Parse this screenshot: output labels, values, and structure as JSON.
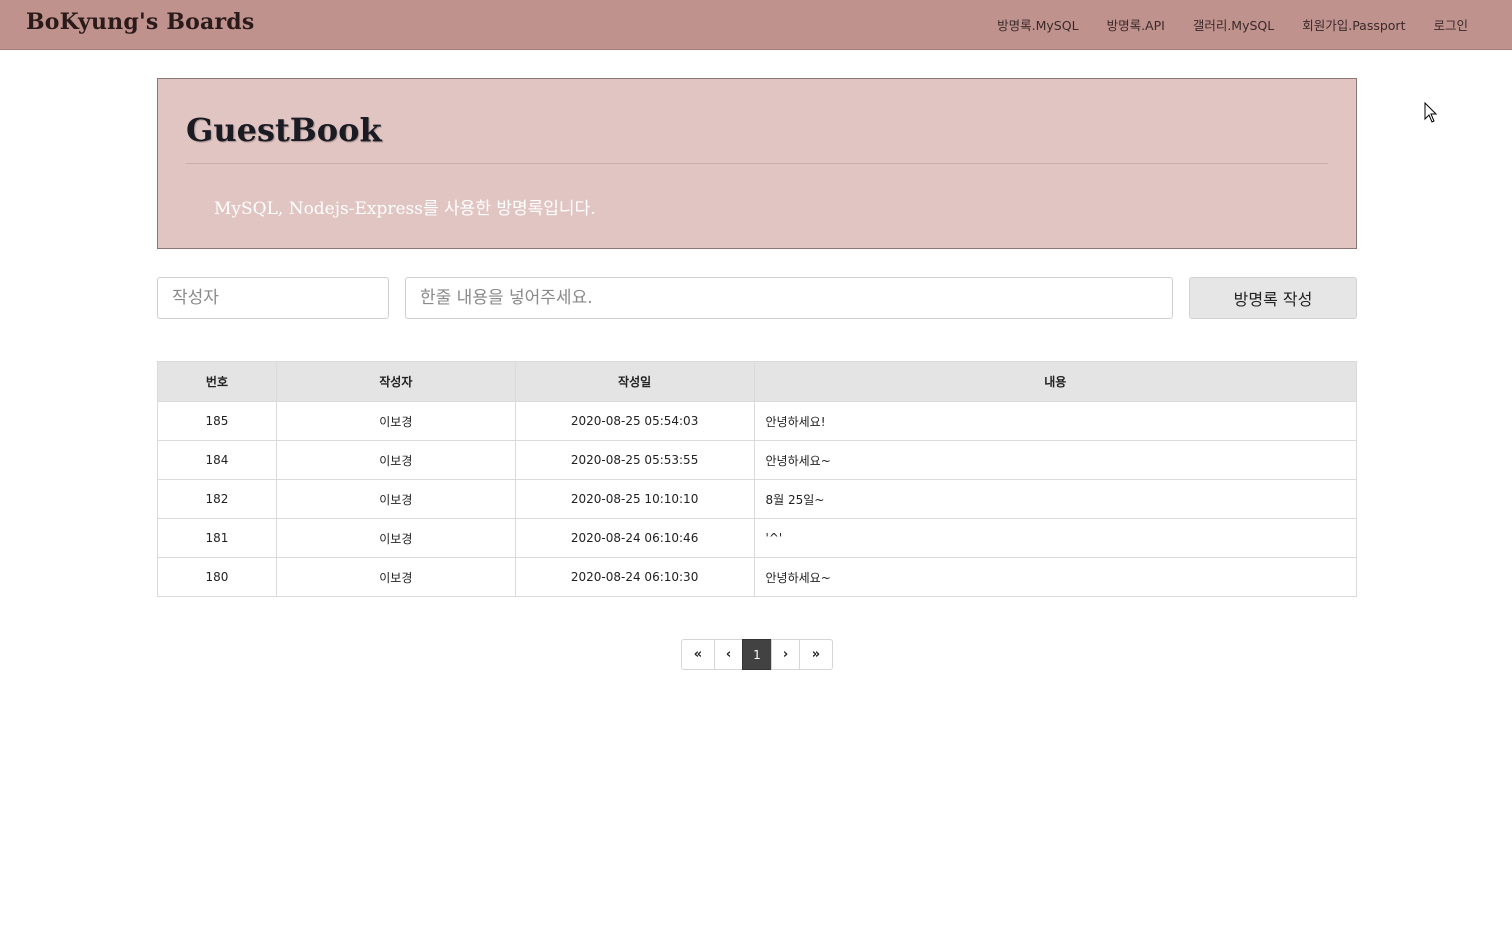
{
  "navbar": {
    "brand": "BoKyung's Boards",
    "items": [
      {
        "label": "방명록.MySQL"
      },
      {
        "label": "방명록.API"
      },
      {
        "label": "갤러리.MySQL"
      },
      {
        "label": "회원가입.Passport"
      },
      {
        "label": "로그인"
      }
    ],
    "bg_color": "#c0928d"
  },
  "jumbotron": {
    "title": "GuestBook",
    "description": "MySQL, Nodejs-Express를 사용한 방명록입니다.",
    "bg_color": "#e1c5c2"
  },
  "form": {
    "writer_placeholder": "작성자",
    "content_placeholder": "한줄 내용을 넣어주세요.",
    "submit_label": "방명록 작성"
  },
  "table": {
    "headers": [
      "번호",
      "작성자",
      "작성일",
      "내용"
    ],
    "rows": [
      {
        "id": "185",
        "writer": "이보경",
        "date": "2020-08-25 05:54:03",
        "content": "안녕하세요!"
      },
      {
        "id": "184",
        "writer": "이보경",
        "date": "2020-08-25 05:53:55",
        "content": "안녕하세요~"
      },
      {
        "id": "182",
        "writer": "이보경",
        "date": "2020-08-25 10:10:10",
        "content": "8월 25일~"
      },
      {
        "id": "181",
        "writer": "이보경",
        "date": "2020-08-24 06:10:46",
        "content": "'^'"
      },
      {
        "id": "180",
        "writer": "이보경",
        "date": "2020-08-24 06:10:30",
        "content": "안녕하세요~"
      }
    ]
  },
  "pagination": {
    "first": "«",
    "prev": "‹",
    "current": "1",
    "next": "›",
    "last": "»",
    "active_color": "#424242"
  }
}
